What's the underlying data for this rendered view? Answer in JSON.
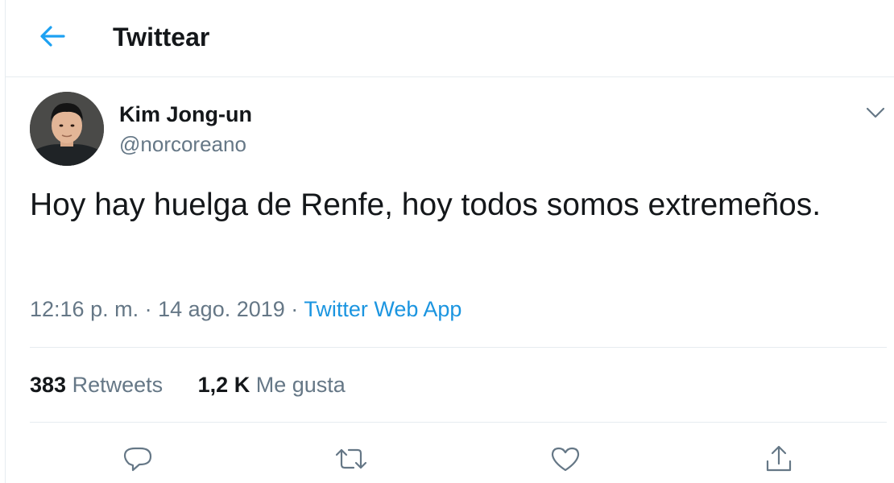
{
  "header": {
    "title": "Twittear",
    "back_icon": "arrow-left-icon"
  },
  "tweet": {
    "author_name": "Kim Jong-un",
    "author_handle": "@norcoreano",
    "text": "Hoy hay huelga de Renfe, hoy todos somos extremeños.",
    "time": "12:16 p. m.",
    "date": "14 ago. 2019",
    "separator": "·",
    "source": "Twitter Web App",
    "caret_icon": "chevron-down-icon"
  },
  "stats": {
    "retweets_count": "383",
    "retweets_label": "Retweets",
    "likes_count": "1,2 K",
    "likes_label": "Me gusta"
  },
  "actions": [
    "reply-icon",
    "retweet-icon",
    "like-icon",
    "share-icon"
  ],
  "colors": {
    "accent": "#1da1f2",
    "link": "#1b95e0",
    "secondary_text": "#657786",
    "divider": "#e6ecf0"
  }
}
